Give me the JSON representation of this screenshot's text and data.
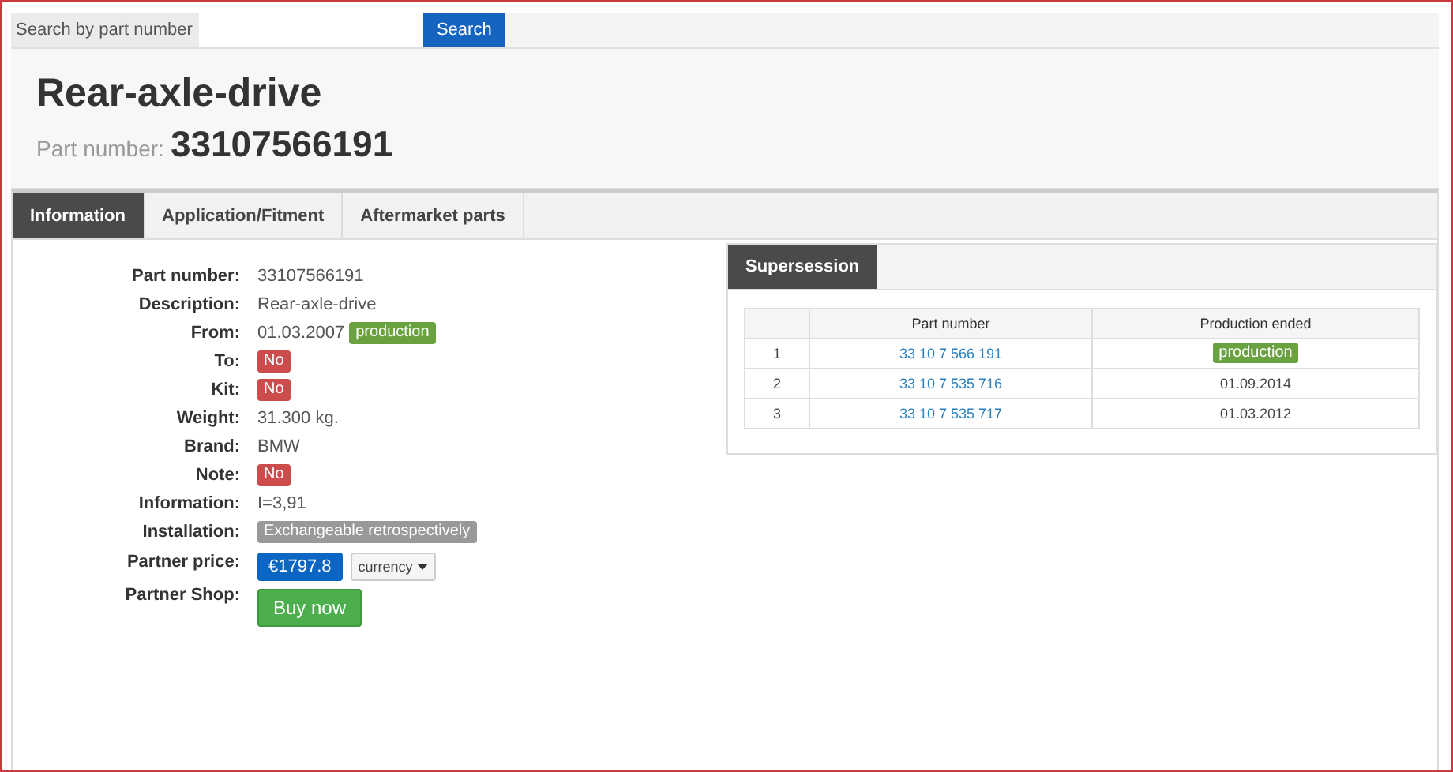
{
  "search": {
    "label": "Search by part number",
    "button": "Search"
  },
  "header": {
    "title": "Rear-axle-drive",
    "part_label": "Part number:",
    "part_number": "33107566191"
  },
  "tabs": [
    {
      "label": "Information",
      "selected": true
    },
    {
      "label": "Application/Fitment",
      "selected": false
    },
    {
      "label": "Aftermarket parts",
      "selected": false
    }
  ],
  "details": [
    {
      "label": "Part number:",
      "kind": "text",
      "value": "33107566191"
    },
    {
      "label": "Description:",
      "kind": "text",
      "value": "Rear-axle-drive"
    },
    {
      "label": "From:",
      "kind": "text",
      "value": "01.03.2007",
      "badge": {
        "text": "production",
        "kind": "success"
      }
    },
    {
      "label": "To:",
      "kind": "badge",
      "badge": {
        "text": "No",
        "kind": "danger"
      }
    },
    {
      "label": "Kit:",
      "kind": "badge",
      "badge": {
        "text": "No",
        "kind": "danger"
      }
    },
    {
      "label": "Weight:",
      "kind": "text",
      "value": "31.300 kg."
    },
    {
      "label": "Brand:",
      "kind": "text",
      "value": "BMW"
    },
    {
      "label": "Note:",
      "kind": "badge",
      "badge": {
        "text": "No",
        "kind": "danger"
      }
    },
    {
      "label": "Information:",
      "kind": "text",
      "value": "I=3,91"
    },
    {
      "label": "Installation:",
      "kind": "badge",
      "badge": {
        "text": "Exchangeable retrospectively",
        "kind": "default"
      }
    },
    {
      "label": "Partner price:",
      "kind": "price",
      "value": "€1797.8",
      "dropdown": "currency"
    },
    {
      "label": "Partner Shop:",
      "kind": "button",
      "value": "Buy now"
    }
  ],
  "supersession": {
    "title": "Supersession",
    "columns": [
      "Part number",
      "Production ended"
    ],
    "rows": [
      {
        "index": "1",
        "part_number": "33 10 7 566 191",
        "ended": {
          "kind": "badge",
          "text": "production"
        }
      },
      {
        "index": "2",
        "part_number": "33 10 7 535 716",
        "ended": {
          "kind": "text",
          "text": "01.09.2014"
        }
      },
      {
        "index": "3",
        "part_number": "33 10 7 535 717",
        "ended": {
          "kind": "text",
          "text": "01.03.2012"
        }
      }
    ]
  }
}
